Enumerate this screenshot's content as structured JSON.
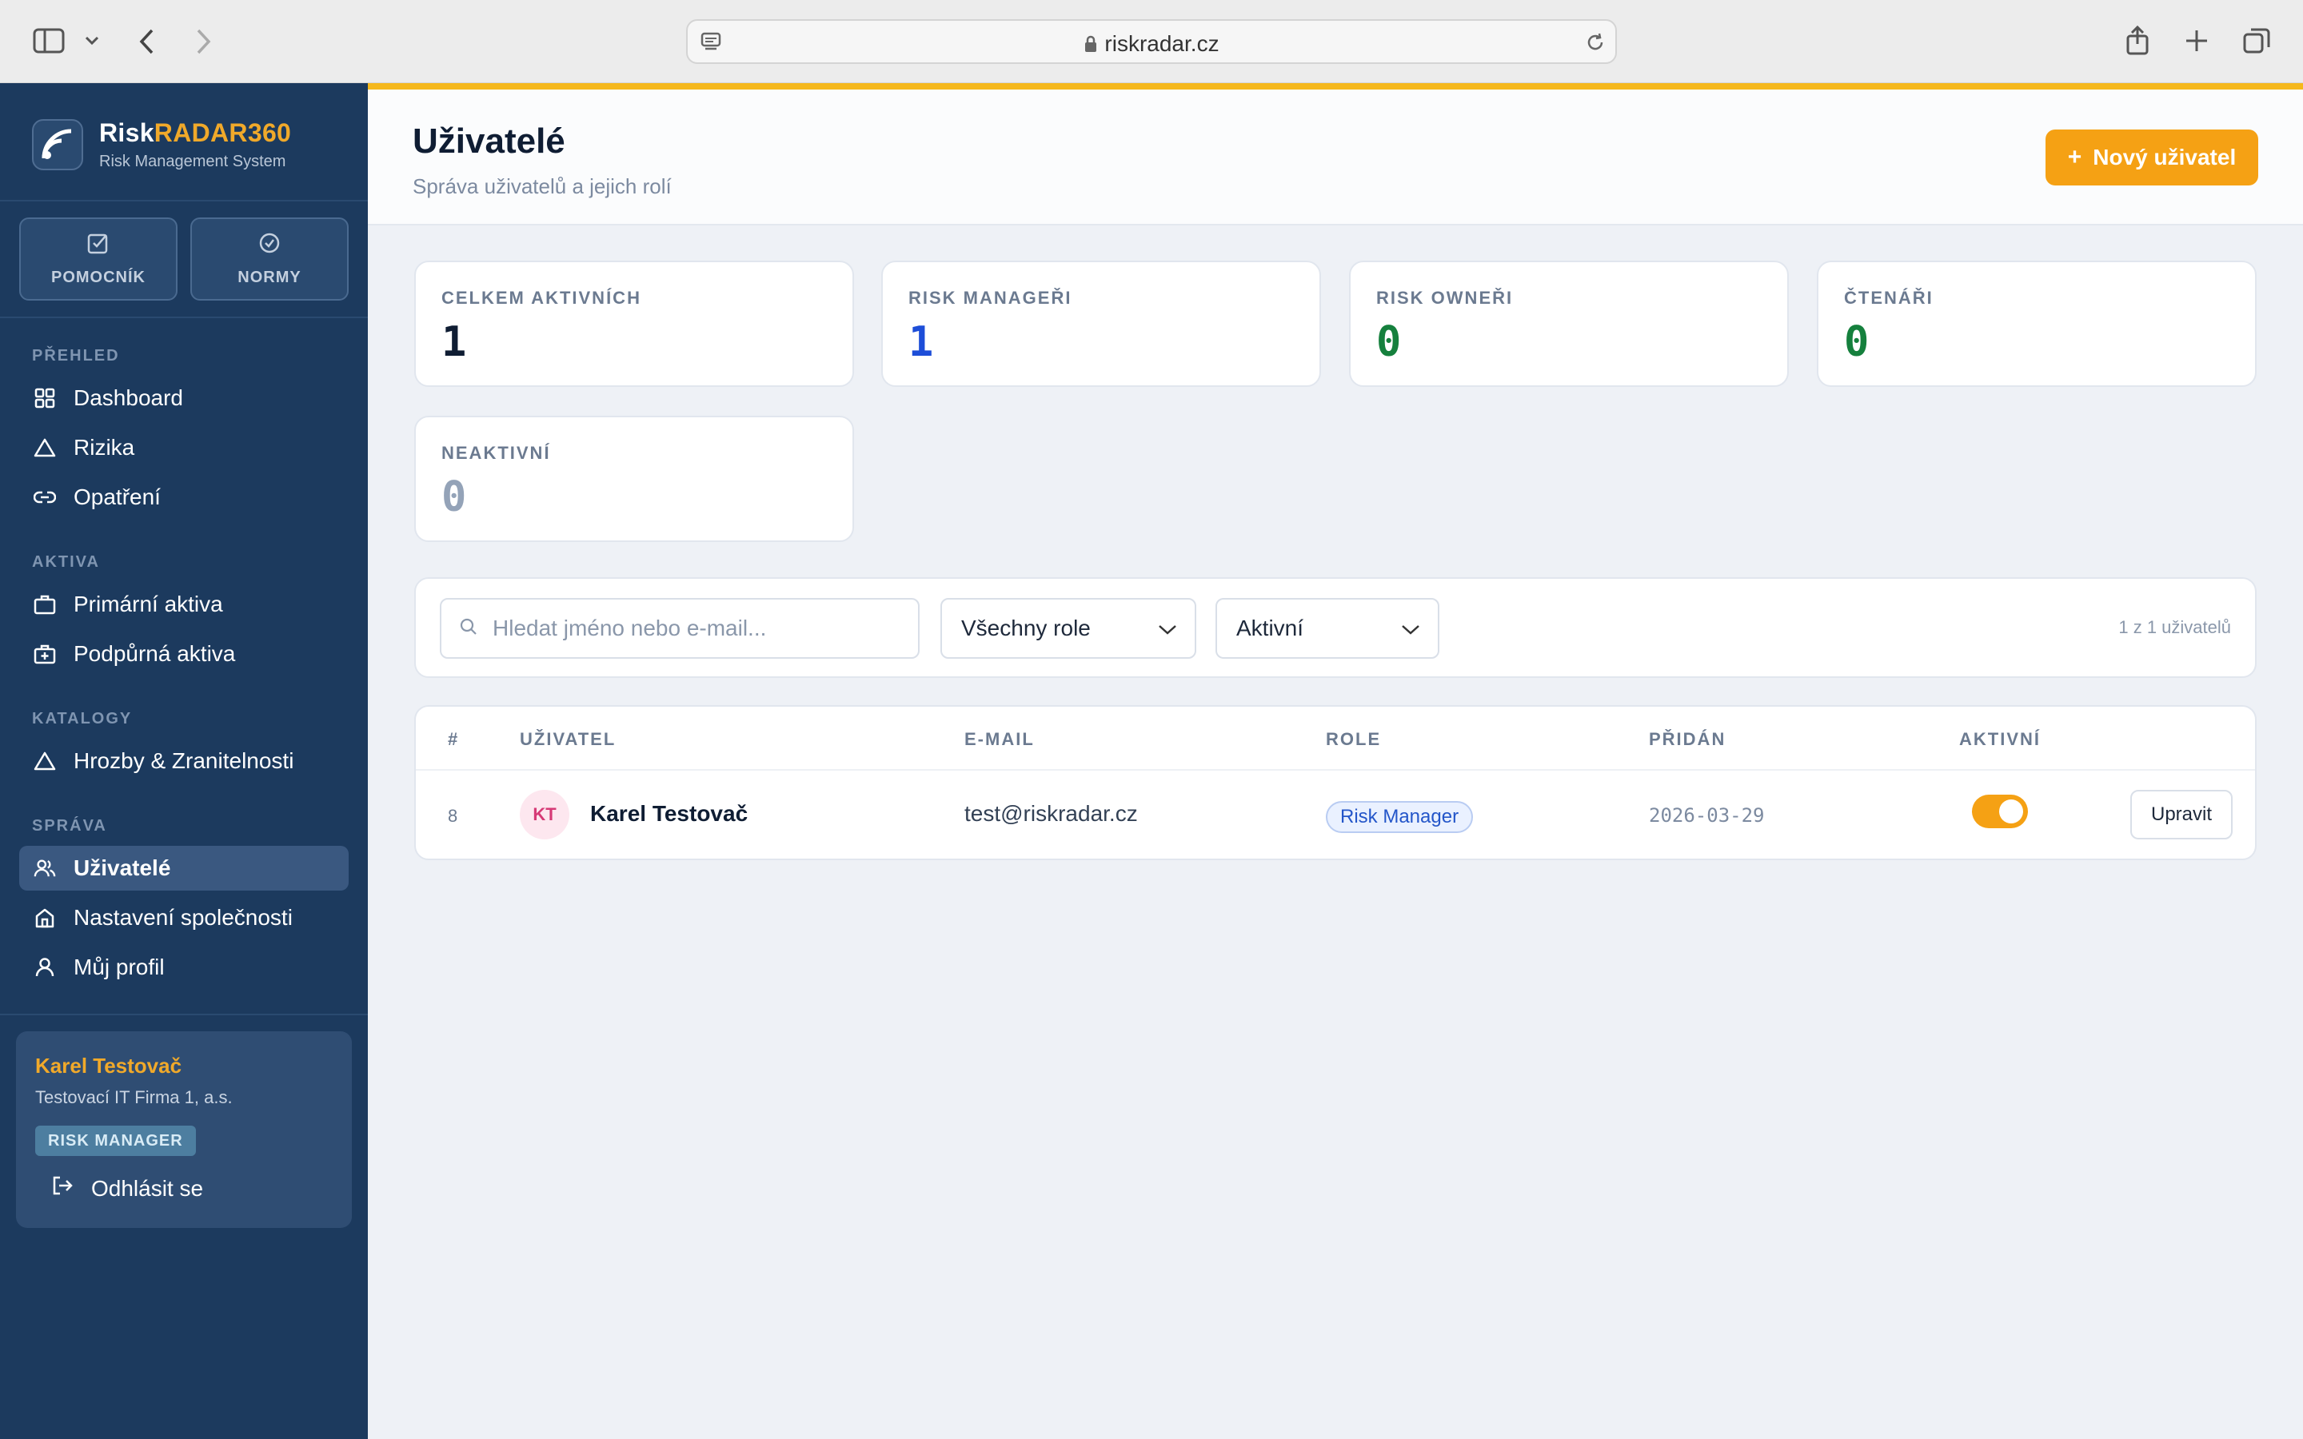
{
  "browser": {
    "url": "riskradar.cz"
  },
  "sidebar": {
    "brand": {
      "name_part1": "Risk",
      "name_part2": "RADAR360",
      "subtitle": "Risk Management System"
    },
    "quick_buttons": [
      {
        "label": "POMOCNÍK",
        "icon": "edit-check-icon"
      },
      {
        "label": "NORMY",
        "icon": "check-circle-icon"
      }
    ],
    "sections": [
      {
        "label": "PŘEHLED",
        "items": [
          {
            "label": "Dashboard",
            "icon": "grid-icon"
          },
          {
            "label": "Rizika",
            "icon": "warning-triangle-icon"
          },
          {
            "label": "Opatření",
            "icon": "link-icon"
          }
        ]
      },
      {
        "label": "AKTIVA",
        "items": [
          {
            "label": "Primární aktiva",
            "icon": "briefcase-icon"
          },
          {
            "label": "Podpůrná aktiva",
            "icon": "briefcase-plus-icon"
          }
        ]
      },
      {
        "label": "KATALOGY",
        "items": [
          {
            "label": "Hrozby & Zranitelnosti",
            "icon": "warning-triangle-icon"
          }
        ]
      },
      {
        "label": "SPRÁVA",
        "items": [
          {
            "label": "Uživatelé",
            "icon": "users-icon",
            "active": true
          },
          {
            "label": "Nastavení společnosti",
            "icon": "home-icon"
          },
          {
            "label": "Můj profil",
            "icon": "user-icon"
          }
        ]
      }
    ],
    "user_card": {
      "name": "Karel Testovač",
      "company": "Testovací IT Firma 1, a.s.",
      "role": "RISK MANAGER",
      "logout_label": "Odhlásit se"
    }
  },
  "header": {
    "title": "Uživatelé",
    "subtitle": "Správa uživatelů a jejich rolí",
    "new_user_label": "Nový uživatel"
  },
  "stats": [
    {
      "label": "CELKEM AKTIVNÍCH",
      "value": "1",
      "color": "#0f1d33"
    },
    {
      "label": "RISK MANAGEŘI",
      "value": "1",
      "color": "#1d4ed8"
    },
    {
      "label": "RISK OWNEŘI",
      "value": "0",
      "color": "#15803d"
    },
    {
      "label": "ČTENÁŘI",
      "value": "0",
      "color": "#15803d"
    },
    {
      "label": "NEAKTIVNÍ",
      "value": "0",
      "color": "#94a3b8"
    }
  ],
  "filters": {
    "search_placeholder": "Hledat jméno nebo e-mail...",
    "role_selected": "Všechny role",
    "status_selected": "Aktivní",
    "count_text": "1 z 1 uživatelů"
  },
  "table": {
    "columns": [
      "#",
      "UŽIVATEL",
      "E-MAIL",
      "ROLE",
      "PŘIDÁN",
      "AKTIVNÍ"
    ],
    "rows": [
      {
        "id": "8",
        "initials": "KT",
        "name": "Karel Testovač",
        "email": "test@riskradar.cz",
        "role": "Risk Manager",
        "added": "2026-03-29",
        "active": true,
        "edit_label": "Upravit"
      }
    ]
  },
  "colors": {
    "accent": "#f5a114",
    "sidebar": "#1c3a5e",
    "brand_accent": "#f0a92a"
  }
}
